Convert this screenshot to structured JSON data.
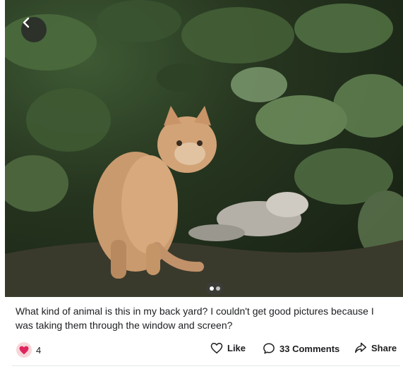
{
  "post": {
    "image_alt_icon": "cat-photo",
    "pager": {
      "current": 1,
      "total": 2
    },
    "caption": "What kind of animal is this in my back yard?  I couldn't get good pictures because I was taking them through the window and screen?",
    "reactions": {
      "icon": "heart-icon",
      "count": "4",
      "color": "#e0245e"
    },
    "actions": {
      "like_label": "Like",
      "comments_label": "33 Comments",
      "share_label": "Share"
    }
  }
}
